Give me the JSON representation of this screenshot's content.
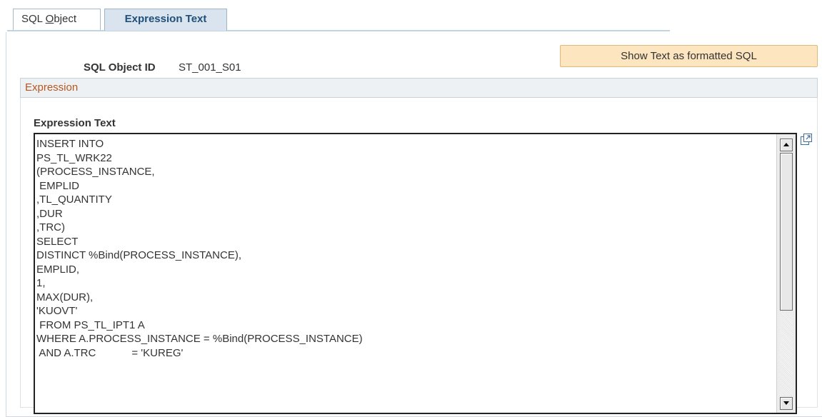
{
  "tabs": [
    {
      "label_pre": "SQL ",
      "label_ul": "O",
      "label_post": "bject",
      "active": false
    },
    {
      "label": "Expression Text",
      "active": true
    }
  ],
  "header": {
    "sql_object_id_label": "SQL Object ID",
    "sql_object_id_value": "ST_001_S01",
    "show_formatted_button": "Show Text as formatted SQL"
  },
  "group": {
    "title": "Expression",
    "field_label": "Expression Text",
    "expression_text": "INSERT INTO\nPS_TL_WRK22\n(PROCESS_INSTANCE,\n EMPLID\n,TL_QUANTITY\n,DUR\n,TRC)\nSELECT\nDISTINCT %Bind(PROCESS_INSTANCE),\nEMPLID,\n1,\nMAX(DUR),\n'KUOVT'\n FROM PS_TL_IPT1 A\nWHERE A.PROCESS_INSTANCE = %Bind(PROCESS_INSTANCE)\n AND A.TRC            = 'KUREG'"
  },
  "icons": {
    "expand": "expand-window-icon",
    "scroll_up": "scroll-up-arrow-icon",
    "scroll_down": "scroll-down-arrow-icon"
  },
  "colors": {
    "tab_active_bg": "#d9e4ee",
    "button_bg": "#fce5bf",
    "group_title": "#b5561d"
  }
}
